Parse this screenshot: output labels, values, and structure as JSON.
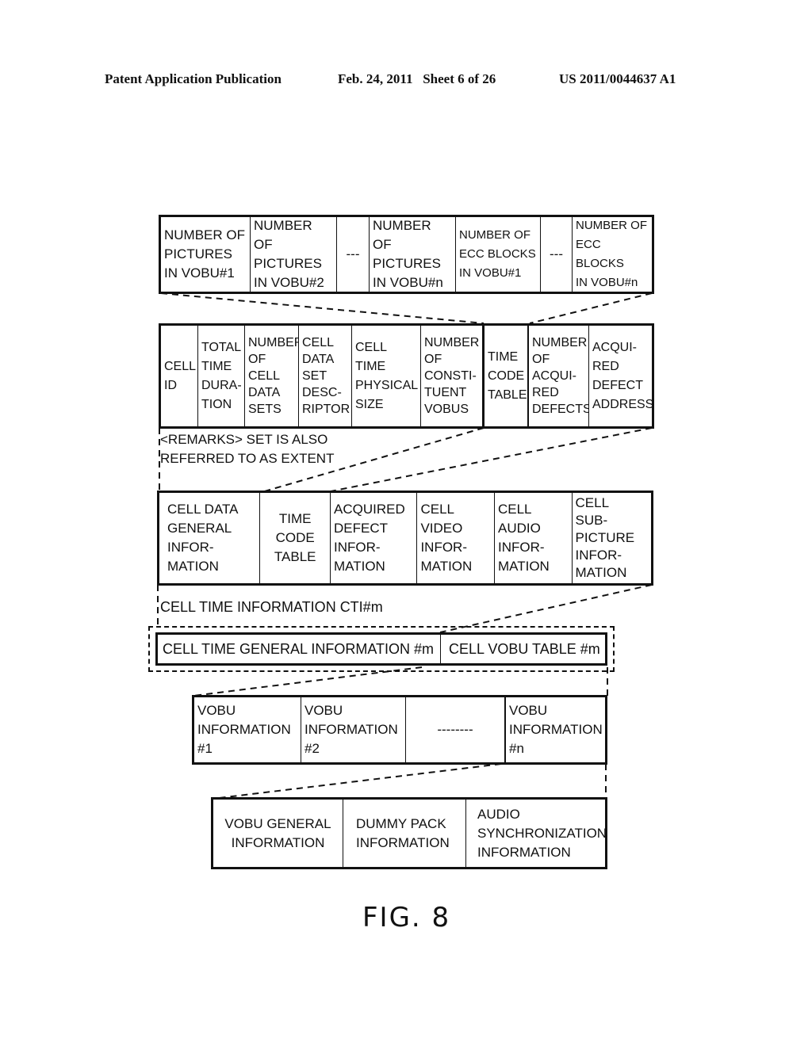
{
  "header": {
    "publication": "Patent Application Publication",
    "date_sheet": "Feb. 24, 2011   Sheet 6 of 26",
    "patent_number": "US 2011/0044637 A1"
  },
  "row1": [
    "NUMBER OF\nPICTURES\nIN VOBU#1",
    "NUMBER OF\nPICTURES\nIN VOBU#2",
    "---",
    "NUMBER OF\nPICTURES\nIN VOBU#n",
    "NUMBER OF\nECC BLOCKS\nIN VOBU#1",
    "---",
    "NUMBER OF\nECC BLOCKS\nIN VOBU#n"
  ],
  "row2": [
    "CELL\nID",
    "TOTAL\nTIME\nDURA-\nTION",
    "NUMBER\nOF\nCELL\nDATA\nSETS",
    "CELL\nDATA\nSET\nDESC-\nRIPTOR",
    "CELL\nTIME\nPHYSICAL\nSIZE",
    "NUMBER\nOF\nCONSTI-\nTUENT\nVOBUS",
    "TIME\nCODE\nTABLE",
    "NUMBER\nOF\nACQUI-\nRED\nDEFECTS",
    "ACQUI-\nRED\nDEFECT\nADDRESS"
  ],
  "remarks": "<REMARKS> SET IS ALSO\nREFERRED TO AS EXTENT",
  "row3": [
    "CELL DATA\nGENERAL\nINFOR-\nMATION",
    "TIME\nCODE\nTABLE",
    "ACQUIRED\nDEFECT\nINFOR-\nMATION",
    "CELL\nVIDEO\nINFOR-\nMATION",
    "CELL\nAUDIO\nINFOR-\nMATION",
    "CELL\nSUB-\nPICTURE\nINFOR-\nMATION"
  ],
  "cti_label": "CELL TIME INFORMATION CTI#m",
  "row4": [
    "CELL TIME GENERAL INFORMATION #m",
    "CELL VOBU TABLE #m"
  ],
  "row5": [
    "VOBU\nINFORMATION\n#1",
    "VOBU\nINFORMATION\n#2",
    "--------",
    "VOBU\nINFORMATION\n#n"
  ],
  "row6": [
    "VOBU GENERAL\nINFORMATION",
    "DUMMY PACK\nINFORMATION",
    "AUDIO\nSYNCHRONIZATION\nINFORMATION"
  ],
  "figure_label": "FIG. 8"
}
